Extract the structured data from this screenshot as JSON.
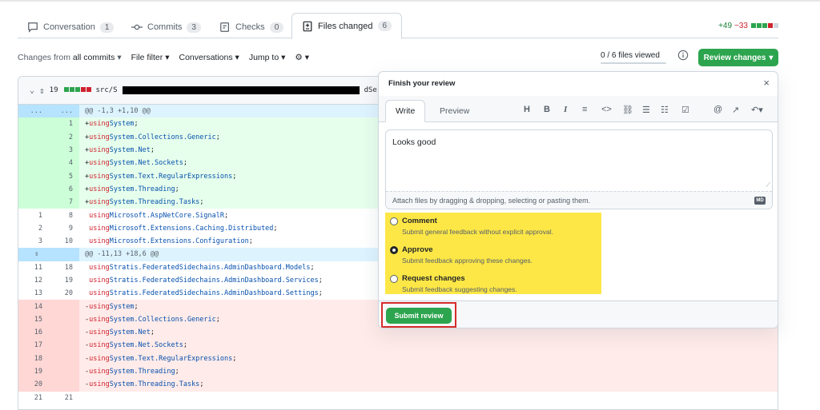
{
  "tabs": {
    "conversation": {
      "label": "Conversation",
      "count": "1"
    },
    "commits": {
      "label": "Commits",
      "count": "3"
    },
    "checks": {
      "label": "Checks",
      "count": "0"
    },
    "files_changed": {
      "label": "Files changed",
      "count": "6"
    }
  },
  "diffstat": {
    "additions": "+49",
    "deletions": "−33"
  },
  "toolbar": {
    "changes_from_prefix": "Changes from",
    "changes_from_value": "all commits",
    "file_filter": "File filter",
    "conversations": "Conversations",
    "jump_to": "Jump to"
  },
  "files_viewed": "0 / 6 files viewed",
  "review_changes_label": "Review changes",
  "file": {
    "changes_count": "19",
    "path_prefix": "src/S",
    "path_suffix": "dSer"
  },
  "diff_lines": [
    {
      "type": "hunk",
      "old": "...",
      "new": "...",
      "text": "@@ -1,3 +1,10 @@"
    },
    {
      "type": "add",
      "old": "",
      "new": "1",
      "sign": "+",
      "kw": "using",
      "ns": "System",
      "end": ";"
    },
    {
      "type": "add",
      "old": "",
      "new": "2",
      "sign": "+",
      "kw": "using",
      "ns": "System.Collections.Generic",
      "end": ";"
    },
    {
      "type": "add",
      "old": "",
      "new": "3",
      "sign": "+",
      "kw": "using",
      "ns": "System.Net",
      "end": ";"
    },
    {
      "type": "add",
      "old": "",
      "new": "4",
      "sign": "+",
      "kw": "using",
      "ns": "System.Net.Sockets",
      "end": ";"
    },
    {
      "type": "add",
      "old": "",
      "new": "5",
      "sign": "+",
      "kw": "using",
      "ns": "System.Text.RegularExpressions",
      "end": ";"
    },
    {
      "type": "add",
      "old": "",
      "new": "6",
      "sign": "+",
      "kw": "using",
      "ns": "System.Threading",
      "end": ";"
    },
    {
      "type": "add",
      "old": "",
      "new": "7",
      "sign": "+",
      "kw": "using",
      "ns": "System.Threading.Tasks",
      "end": ";"
    },
    {
      "type": "ctx",
      "old": "1",
      "new": "8",
      "sign": " ",
      "kw": "using",
      "ns": "Microsoft.AspNetCore.SignalR",
      "end": ";"
    },
    {
      "type": "ctx",
      "old": "2",
      "new": "9",
      "sign": " ",
      "kw": "using",
      "ns": "Microsoft.Extensions.Caching.Distributed",
      "end": ";"
    },
    {
      "type": "ctx",
      "old": "3",
      "new": "10",
      "sign": " ",
      "kw": "using",
      "ns": "Microsoft.Extensions.Configuration",
      "end": ";"
    },
    {
      "type": "hunk",
      "old": "",
      "new": "",
      "text": "@@ -11,13 +18,6 @@"
    },
    {
      "type": "ctx",
      "old": "11",
      "new": "18",
      "sign": " ",
      "kw": "using",
      "ns": "Stratis.FederatedSidechains.AdminDashboard.Models",
      "end": ";"
    },
    {
      "type": "ctx",
      "old": "12",
      "new": "19",
      "sign": " ",
      "kw": "using",
      "ns": "Stratis.FederatedSidechains.AdminDashboard.Services",
      "end": ";"
    },
    {
      "type": "ctx",
      "old": "13",
      "new": "20",
      "sign": " ",
      "kw": "using",
      "ns": "Stratis.FederatedSidechains.AdminDashboard.Settings",
      "end": ";"
    },
    {
      "type": "del",
      "old": "14",
      "new": "",
      "sign": "-",
      "kw": "using",
      "ns": "System",
      "end": ";"
    },
    {
      "type": "del",
      "old": "15",
      "new": "",
      "sign": "-",
      "kw": "using",
      "ns": "System.Collections.Generic",
      "end": ";"
    },
    {
      "type": "del",
      "old": "16",
      "new": "",
      "sign": "-",
      "kw": "using",
      "ns": "System.Net",
      "end": ";"
    },
    {
      "type": "del",
      "old": "17",
      "new": "",
      "sign": "-",
      "kw": "using",
      "ns": "System.Net.Sockets",
      "end": ";"
    },
    {
      "type": "del",
      "old": "18",
      "new": "",
      "sign": "-",
      "kw": "using",
      "ns": "System.Text.RegularExpressions",
      "end": ";"
    },
    {
      "type": "del",
      "old": "19",
      "new": "",
      "sign": "-",
      "kw": "using",
      "ns": "System.Threading",
      "end": ";"
    },
    {
      "type": "del",
      "old": "20",
      "new": "",
      "sign": "-",
      "kw": "using",
      "ns": "System.Threading.Tasks",
      "end": ";"
    },
    {
      "type": "ctx",
      "old": "21",
      "new": "21",
      "sign": " ",
      "kw": "",
      "ns": "",
      "end": ""
    }
  ],
  "review": {
    "title": "Finish your review",
    "close": "×",
    "write_tab": "Write",
    "preview_tab": "Preview",
    "comment_value": "Looks good",
    "attach_hint": "Attach files by dragging & dropping, selecting or pasting them.",
    "markdown_badge": "MD",
    "options": [
      {
        "title": "Comment",
        "desc": "Submit general feedback without explicit approval.",
        "checked": false
      },
      {
        "title": "Approve",
        "desc": "Submit feedback approving these changes.",
        "checked": true
      },
      {
        "title": "Request changes",
        "desc": "Submit feedback suggesting changes.",
        "checked": false
      }
    ],
    "submit_label": "Submit review"
  },
  "colors": {
    "accent_green": "#2da44e",
    "highlight_yellow": "#fde746",
    "highlight_red": "#d62b2b"
  }
}
